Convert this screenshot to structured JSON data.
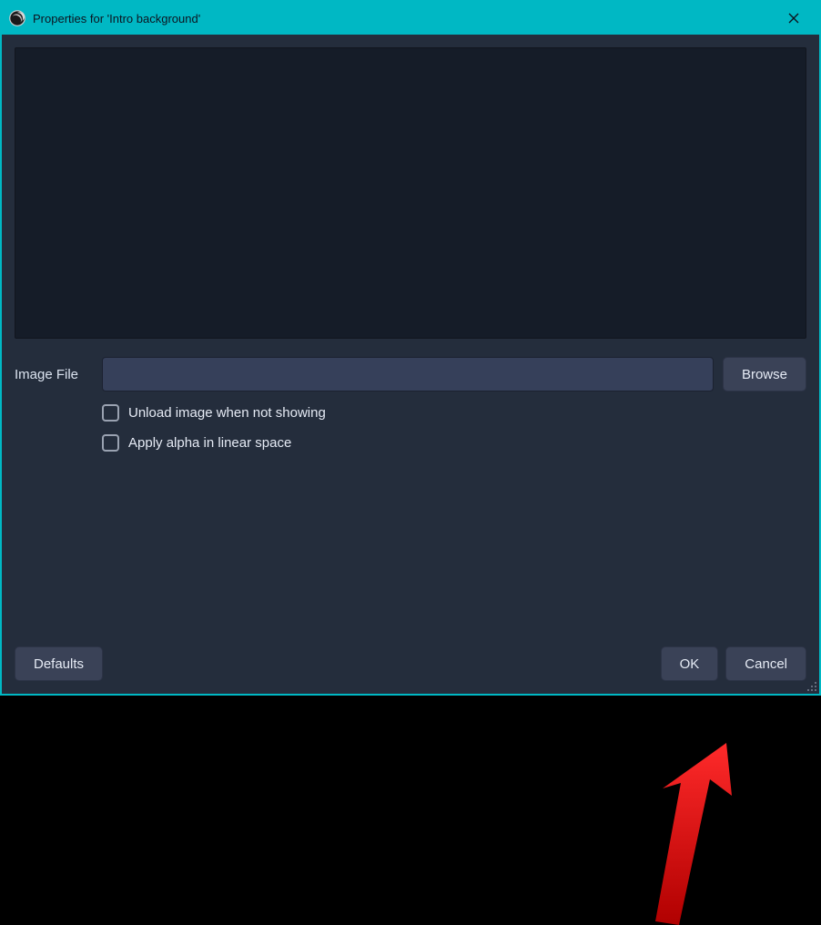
{
  "titlebar": {
    "title": "Properties for 'Intro background'"
  },
  "form": {
    "image_file_label": "Image File",
    "image_file_value": "",
    "browse_label": "Browse",
    "checkbox_unload_label": "Unload image when not showing",
    "checkbox_alpha_label": "Apply alpha in linear space"
  },
  "footer": {
    "defaults_label": "Defaults",
    "ok_label": "OK",
    "cancel_label": "Cancel"
  },
  "annotation": {
    "arrow_color": "#ff1a1a"
  }
}
